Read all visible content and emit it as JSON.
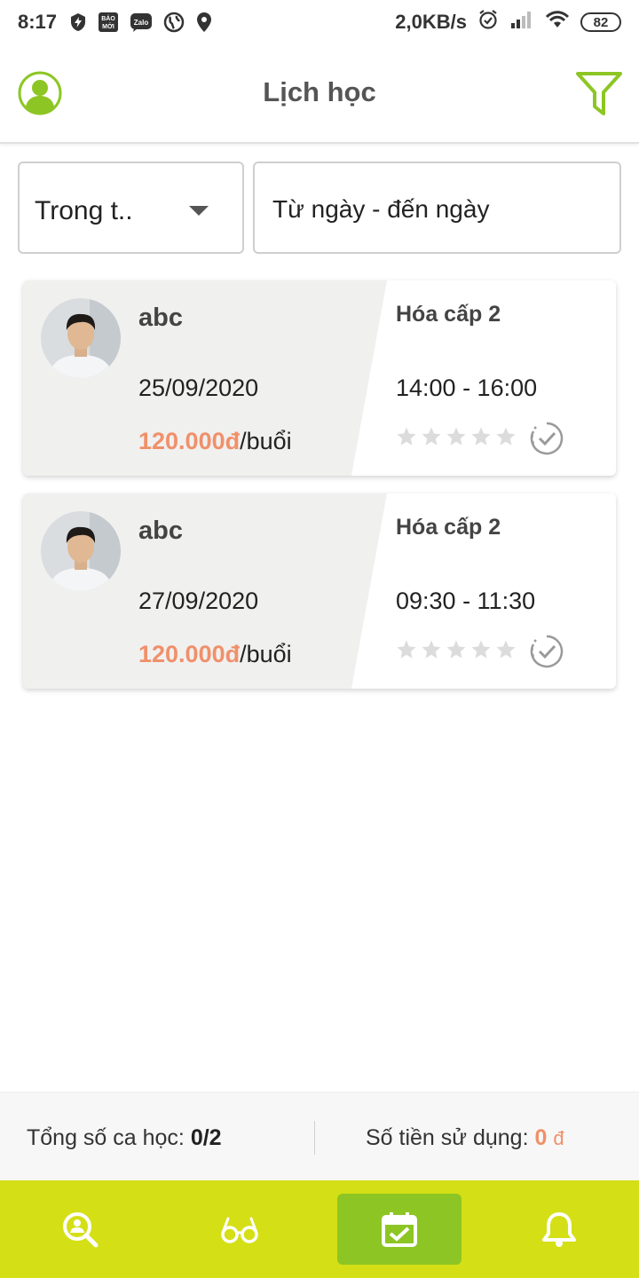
{
  "status_bar": {
    "time": "8:17",
    "notification_icons": [
      "charging-bolt-icon",
      "baomoi-icon",
      "zalo-icon",
      "globe-icon",
      "location-icon"
    ],
    "baomoi_label_line1": "BÁO",
    "baomoi_label_line2": "MỚI",
    "zalo_label": "Zalo",
    "network_speed": "2,0KB/s",
    "battery": "82"
  },
  "header": {
    "title": "Lịch học"
  },
  "filters": {
    "period_select": "Trong t..",
    "date_range_placeholder": "Từ ngày - đến ngày"
  },
  "sessions": [
    {
      "name": "abc",
      "date": "25/09/2020",
      "price": "120.000đ",
      "unit": "/buổi",
      "subject": "Hóa cấp 2",
      "time": "14:00 - 16:00",
      "rating": 0
    },
    {
      "name": "abc",
      "date": "27/09/2020",
      "price": "120.000đ",
      "unit": "/buổi",
      "subject": "Hóa cấp 2",
      "time": "09:30 - 11:30",
      "rating": 0
    }
  ],
  "summary": {
    "sessions_label": "Tổng số ca học: ",
    "sessions_value": "0/2",
    "money_label": "Số tiền sử dụng: ",
    "money_value": "0",
    "currency": "đ"
  },
  "bottom_nav": {
    "items": [
      "search-tutor-icon",
      "glasses-icon",
      "calendar-check-icon",
      "bell-icon"
    ],
    "active_index": 2
  },
  "colors": {
    "accent_green": "#8dc624",
    "nav_bar": "#d4df16",
    "price_orange": "#f0906a",
    "card_left_bg": "#f0f0ef"
  }
}
